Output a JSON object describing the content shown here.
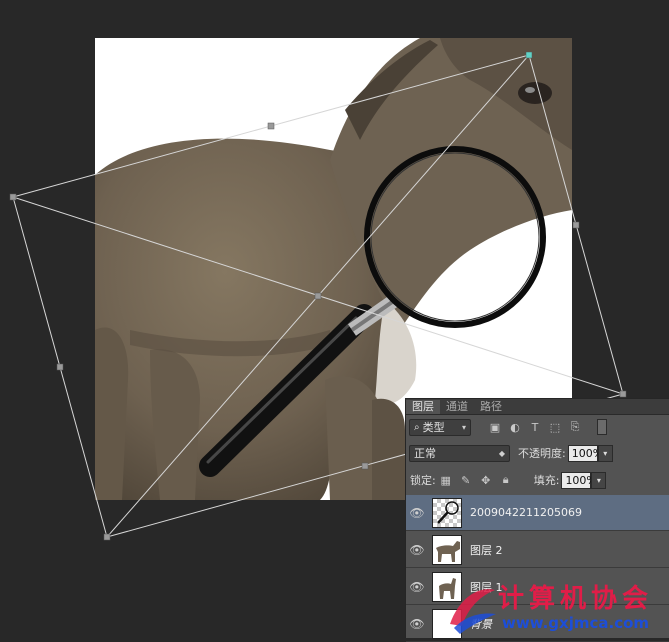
{
  "layers_panel": {
    "tabs": [
      "图层",
      "通道",
      "路径"
    ],
    "filter_kind_label": "类型",
    "blend_mode": "正常",
    "opacity_label": "不透明度:",
    "opacity_value": "100%",
    "lock_label": "锁定:",
    "fill_label": "填充:",
    "fill_value": "100%",
    "layers": [
      {
        "name": "20090422112050​69",
        "selected": true
      },
      {
        "name": "图层 2",
        "selected": false
      },
      {
        "name": "图层 1",
        "selected": false
      },
      {
        "name": "背景",
        "selected": false
      }
    ]
  },
  "watermark": {
    "title": "计算机协会",
    "url": "www.gxjmca.com"
  },
  "colors": {
    "canvas_bg": "#282828",
    "panel_bg": "#535353",
    "selected_row": "#5e6d82",
    "watermark_red": "#e11d48",
    "watermark_blue": "#1d4ed8"
  }
}
